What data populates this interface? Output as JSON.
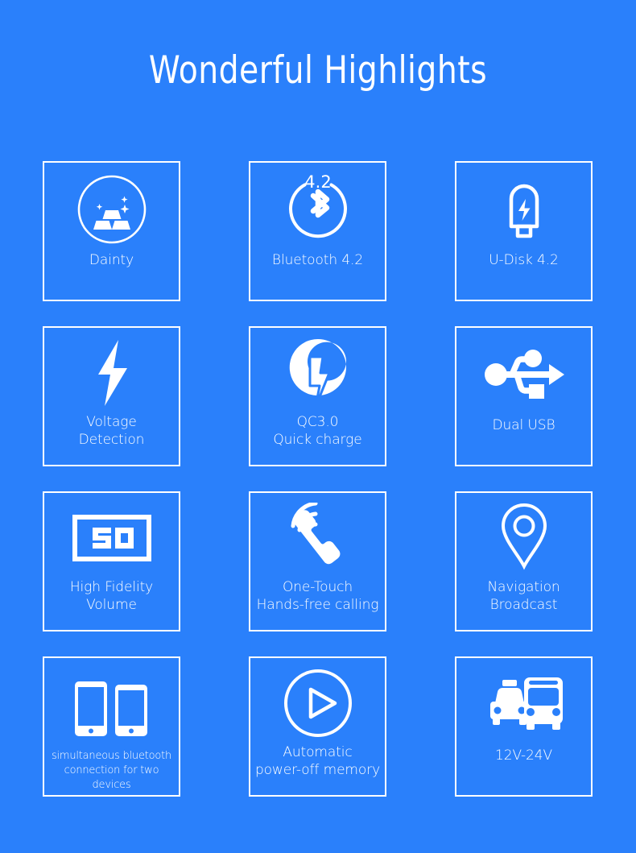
{
  "page": {
    "title": "Wonderful Highlights",
    "background_color": "#2a80fb",
    "foreground_color": "#ffffff"
  },
  "features": [
    {
      "id": "dainty",
      "icon": "gold-bars-in-circle-icon",
      "label_line1": "Dainty",
      "label_line2": ""
    },
    {
      "id": "bluetooth",
      "icon": "bluetooth-4-2-icon",
      "label_line1": "Bluetooth 4.2",
      "label_line2": "",
      "icon_text": "4.2"
    },
    {
      "id": "u-disk",
      "icon": "usb-flash-drive-icon",
      "label_line1": "U-Disk 4.2",
      "label_line2": ""
    },
    {
      "id": "voltage-detection",
      "icon": "lightning-bolt-icon",
      "label_line1": "Voltage",
      "label_line2": "Detection"
    },
    {
      "id": "quick-charge",
      "icon": "quick-charge-icon",
      "label_line1": "QC3.0",
      "label_line2": "Quick charge"
    },
    {
      "id": "dual-usb",
      "icon": "usb-trident-icon",
      "label_line1": "Dual USB",
      "label_line2": ""
    },
    {
      "id": "high-fidelity-volume",
      "icon": "volume-display-icon",
      "label_line1": "High Fidelity",
      "label_line2": "Volume",
      "icon_text": "50"
    },
    {
      "id": "hands-free-calling",
      "icon": "phone-handset-waves-icon",
      "label_line1": "One-Touch",
      "label_line2": "Hands-free calling"
    },
    {
      "id": "navigation-broadcast",
      "icon": "map-pin-icon",
      "label_line1": "Navigation",
      "label_line2": "Broadcast"
    },
    {
      "id": "two-devices",
      "icon": "two-phones-icon",
      "label_line1": "simultaneous bluetooth",
      "label_line2": "connection for two devices"
    },
    {
      "id": "power-off-memory",
      "icon": "play-button-circle-icon",
      "label_line1": "Automatic",
      "label_line2": "power-off memory"
    },
    {
      "id": "voltage-range",
      "icon": "taxi-and-bus-icon",
      "label_line1": "12V-24V",
      "label_line2": ""
    }
  ]
}
